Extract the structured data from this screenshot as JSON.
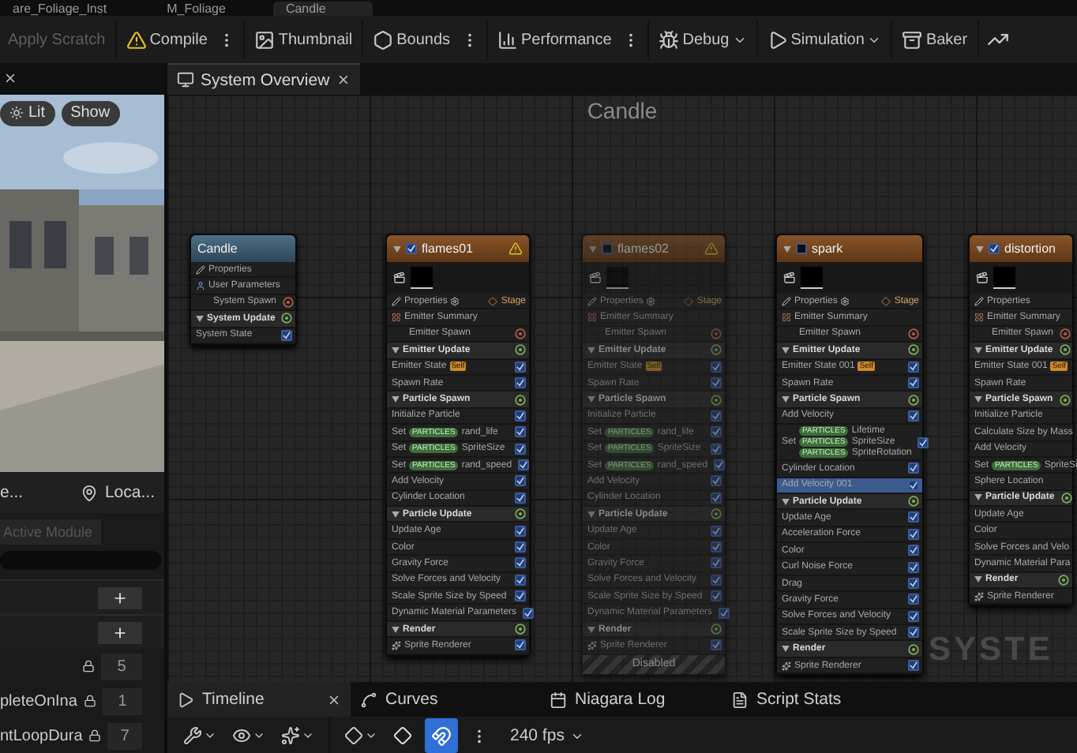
{
  "top_tabs": [
    {
      "label": "are_Foliage_Inst",
      "selected": false
    },
    {
      "label": "M_Foliage",
      "selected": false
    },
    {
      "label": "Candle",
      "selected": true
    }
  ],
  "toolbar": [
    {
      "label": "Apply Scratch",
      "disabled": true,
      "more": false,
      "dropdown": false
    },
    {
      "label": "Compile",
      "disabled": false,
      "more": true,
      "dropdown": false
    },
    {
      "label": "Thumbnail",
      "disabled": false,
      "more": false,
      "dropdown": false
    },
    {
      "label": "Bounds",
      "disabled": false,
      "more": true,
      "dropdown": false
    },
    {
      "label": "Performance",
      "disabled": false,
      "more": true,
      "dropdown": false
    },
    {
      "label": "Debug",
      "disabled": false,
      "more": false,
      "dropdown": true
    },
    {
      "label": "Simulation",
      "disabled": false,
      "more": false,
      "dropdown": true
    },
    {
      "label": "Baker",
      "disabled": false,
      "more": false,
      "dropdown": false
    }
  ],
  "viewport": {
    "buttons": [
      "Lit",
      "Show"
    ]
  },
  "left_tabs": [
    "e...",
    "Loca..."
  ],
  "active_module": "Active Module",
  "params": [
    {
      "value": "5"
    },
    {
      "name": "pleteOnIna",
      "value": "1"
    },
    {
      "name": "ntLoopDura",
      "value": "7"
    }
  ],
  "overview_tab": "System Overview",
  "graph": {
    "title": "Candle",
    "watermark": "SYSTE",
    "system_node": {
      "name": "Candle",
      "rows": [
        {
          "kind": "properties",
          "label": "Properties"
        },
        {
          "kind": "params",
          "label": "User Parameters"
        },
        {
          "kind": "stage",
          "label": "System Spawn"
        },
        {
          "kind": "section",
          "label": "System Update"
        },
        {
          "kind": "module",
          "label": "System State",
          "checked": true,
          "selected": false
        }
      ]
    },
    "emitters": [
      {
        "name": "flames01",
        "enabled": true,
        "warning": true,
        "rows": [
          {
            "kind": "properties",
            "label": "Properties",
            "stage": "Stage"
          },
          {
            "kind": "summary",
            "label": "Emitter Summary"
          },
          {
            "kind": "stage",
            "label": "Emitter Spawn"
          },
          {
            "kind": "section",
            "label": "Emitter Update"
          },
          {
            "kind": "module",
            "label": "Emitter State",
            "tag": "Self",
            "checked": true,
            "selected": false
          },
          {
            "kind": "module",
            "label": "Spawn Rate",
            "checked": true,
            "selected": false
          },
          {
            "kind": "section",
            "label": "Particle Spawn"
          },
          {
            "kind": "module",
            "label": "Initialize Particle",
            "checked": true,
            "selected": false
          },
          {
            "kind": "set",
            "label": "Set",
            "params": [
              {
                "badge": "PARTICLES",
                "name": "rand_life"
              }
            ],
            "checked": true,
            "selected": false
          },
          {
            "kind": "set",
            "label": "Set",
            "params": [
              {
                "badge": "PARTICLES",
                "name": "SpriteSize"
              }
            ],
            "checked": true,
            "selected": false
          },
          {
            "kind": "set",
            "label": "Set",
            "params": [
              {
                "badge": "PARTICLES",
                "name": "rand_speed"
              }
            ],
            "checked": true,
            "selected": false
          },
          {
            "kind": "module",
            "label": "Add Velocity",
            "checked": true,
            "selected": false
          },
          {
            "kind": "module",
            "label": "Cylinder Location",
            "checked": true,
            "selected": false
          },
          {
            "kind": "section",
            "label": "Particle Update"
          },
          {
            "kind": "module",
            "label": "Update Age",
            "checked": true,
            "selected": false
          },
          {
            "kind": "module",
            "label": "Color",
            "checked": true,
            "selected": false
          },
          {
            "kind": "module",
            "label": "Gravity Force",
            "checked": true,
            "selected": false
          },
          {
            "kind": "module",
            "label": "Solve Forces and Velocity",
            "checked": true,
            "selected": false
          },
          {
            "kind": "module",
            "label": "Scale Sprite Size by Speed",
            "checked": true,
            "selected": false
          },
          {
            "kind": "module",
            "label": "Dynamic Material Parameters",
            "checked": true,
            "selected": false
          },
          {
            "kind": "section",
            "label": "Render"
          },
          {
            "kind": "renderer",
            "label": "Sprite Renderer",
            "checked": true,
            "selected": false
          }
        ]
      },
      {
        "name": "flames02",
        "enabled": false,
        "warning": true,
        "status": "Disabled",
        "rows": [
          {
            "kind": "properties",
            "label": "Properties",
            "stage": "Stage"
          },
          {
            "kind": "summary",
            "label": "Emitter Summary"
          },
          {
            "kind": "stage",
            "label": "Emitter Spawn"
          },
          {
            "kind": "section",
            "label": "Emitter Update"
          },
          {
            "kind": "module",
            "label": "Emitter State",
            "tag": "Self",
            "checked": true,
            "selected": false
          },
          {
            "kind": "module",
            "label": "Spawn Rate",
            "checked": true,
            "selected": false
          },
          {
            "kind": "section",
            "label": "Particle Spawn"
          },
          {
            "kind": "module",
            "label": "Initialize Particle",
            "checked": true,
            "selected": false
          },
          {
            "kind": "set",
            "label": "Set",
            "params": [
              {
                "badge": "PARTICLES",
                "name": "rand_life"
              }
            ],
            "checked": true,
            "selected": false
          },
          {
            "kind": "set",
            "label": "Set",
            "params": [
              {
                "badge": "PARTICLES",
                "name": "SpriteSize"
              }
            ],
            "checked": true,
            "selected": false
          },
          {
            "kind": "set",
            "label": "Set",
            "params": [
              {
                "badge": "PARTICLES",
                "name": "rand_speed"
              }
            ],
            "checked": true,
            "selected": false
          },
          {
            "kind": "module",
            "label": "Add Velocity",
            "checked": true,
            "selected": false
          },
          {
            "kind": "module",
            "label": "Cylinder Location",
            "checked": true,
            "selected": false
          },
          {
            "kind": "section",
            "label": "Particle Update"
          },
          {
            "kind": "module",
            "label": "Update Age",
            "checked": true,
            "selected": false
          },
          {
            "kind": "module",
            "label": "Color",
            "checked": true,
            "selected": false
          },
          {
            "kind": "module",
            "label": "Gravity Force",
            "checked": true,
            "selected": false
          },
          {
            "kind": "module",
            "label": "Solve Forces and Velocity",
            "checked": true,
            "selected": false
          },
          {
            "kind": "module",
            "label": "Scale Sprite Size by Speed",
            "checked": true,
            "selected": false
          },
          {
            "kind": "module",
            "label": "Dynamic Material Parameters",
            "checked": true,
            "selected": false
          },
          {
            "kind": "section",
            "label": "Render"
          },
          {
            "kind": "renderer",
            "label": "Sprite Renderer",
            "checked": true,
            "selected": false
          }
        ]
      },
      {
        "name": "spark",
        "enabled": false,
        "warning": false,
        "rows": [
          {
            "kind": "properties",
            "label": "Properties",
            "stage": "Stage"
          },
          {
            "kind": "summary",
            "label": "Emitter Summary"
          },
          {
            "kind": "stage",
            "label": "Emitter Spawn"
          },
          {
            "kind": "section",
            "label": "Emitter Update"
          },
          {
            "kind": "module",
            "label": "Emitter State 001",
            "tag": "Self",
            "checked": true,
            "selected": false
          },
          {
            "kind": "module",
            "label": "Spawn Rate",
            "checked": true,
            "selected": false
          },
          {
            "kind": "section",
            "label": "Particle Spawn"
          },
          {
            "kind": "module",
            "label": "Add Velocity",
            "checked": true,
            "selected": false
          },
          {
            "kind": "set",
            "label": "Set",
            "params": [
              {
                "badge": "PARTICLES",
                "name": "Lifetime"
              },
              {
                "badge": "PARTICLES",
                "name": "SpriteSize"
              },
              {
                "badge": "PARTICLES",
                "name": "SpriteRotation"
              }
            ],
            "checked": true,
            "selected": false
          },
          {
            "kind": "module",
            "label": "Cylinder Location",
            "checked": true,
            "selected": false
          },
          {
            "kind": "module",
            "label": "Add Velocity 001",
            "checked": true,
            "selected": true
          },
          {
            "kind": "section",
            "label": "Particle Update"
          },
          {
            "kind": "module",
            "label": "Update Age",
            "checked": true,
            "selected": false
          },
          {
            "kind": "module",
            "label": "Acceleration Force",
            "checked": true,
            "selected": false
          },
          {
            "kind": "module",
            "label": "Color",
            "checked": true,
            "selected": false
          },
          {
            "kind": "module",
            "label": "Curl Noise Force",
            "checked": true,
            "selected": false
          },
          {
            "kind": "module",
            "label": "Drag",
            "checked": true,
            "selected": false
          },
          {
            "kind": "module",
            "label": "Gravity Force",
            "checked": true,
            "selected": false
          },
          {
            "kind": "module",
            "label": "Solve Forces and Velocity",
            "checked": true,
            "selected": false
          },
          {
            "kind": "module",
            "label": "Scale Sprite Size by Speed",
            "checked": true,
            "selected": false
          },
          {
            "kind": "section",
            "label": "Render"
          },
          {
            "kind": "renderer",
            "label": "Sprite Renderer",
            "checked": true,
            "selected": false
          }
        ]
      },
      {
        "name": "distortion",
        "enabled": true,
        "warning": false,
        "rows": [
          {
            "kind": "properties",
            "label": "Properties"
          },
          {
            "kind": "summary",
            "label": "Emitter Summary"
          },
          {
            "kind": "stage",
            "label": "Emitter Spawn"
          },
          {
            "kind": "section",
            "label": "Emitter Update"
          },
          {
            "kind": "module",
            "label": "Emitter State 001",
            "tag": "Self",
            "selected": false
          },
          {
            "kind": "module",
            "label": "Spawn Rate",
            "selected": false
          },
          {
            "kind": "section",
            "label": "Particle Spawn"
          },
          {
            "kind": "module",
            "label": "Initialize Particle",
            "selected": false
          },
          {
            "kind": "module",
            "label": "Calculate Size by Mass",
            "selected": false
          },
          {
            "kind": "module",
            "label": "Add Velocity",
            "selected": false
          },
          {
            "kind": "set",
            "label": "Set",
            "params": [
              {
                "badge": "PARTICLES",
                "name": "SpriteSi"
              }
            ],
            "selected": false
          },
          {
            "kind": "module",
            "label": "Sphere Location",
            "selected": false
          },
          {
            "kind": "section",
            "label": "Particle Update"
          },
          {
            "kind": "module",
            "label": "Update Age",
            "selected": false
          },
          {
            "kind": "module",
            "label": "Color",
            "selected": false
          },
          {
            "kind": "module",
            "label": "Solve Forces and Velo",
            "selected": false
          },
          {
            "kind": "module",
            "label": "Dynamic Material Para",
            "selected": false
          },
          {
            "kind": "section",
            "label": "Render"
          },
          {
            "kind": "renderer",
            "label": "Sprite Renderer",
            "selected": false
          }
        ]
      }
    ]
  },
  "bottom_tabs": [
    {
      "label": "Timeline",
      "selected": true
    },
    {
      "label": "Curves",
      "selected": false
    },
    {
      "label": "Niagara Log",
      "selected": false
    },
    {
      "label": "Script Stats",
      "selected": false
    }
  ],
  "timeline_toolbar": {
    "snap_on": true,
    "fps": "240 fps"
  }
}
